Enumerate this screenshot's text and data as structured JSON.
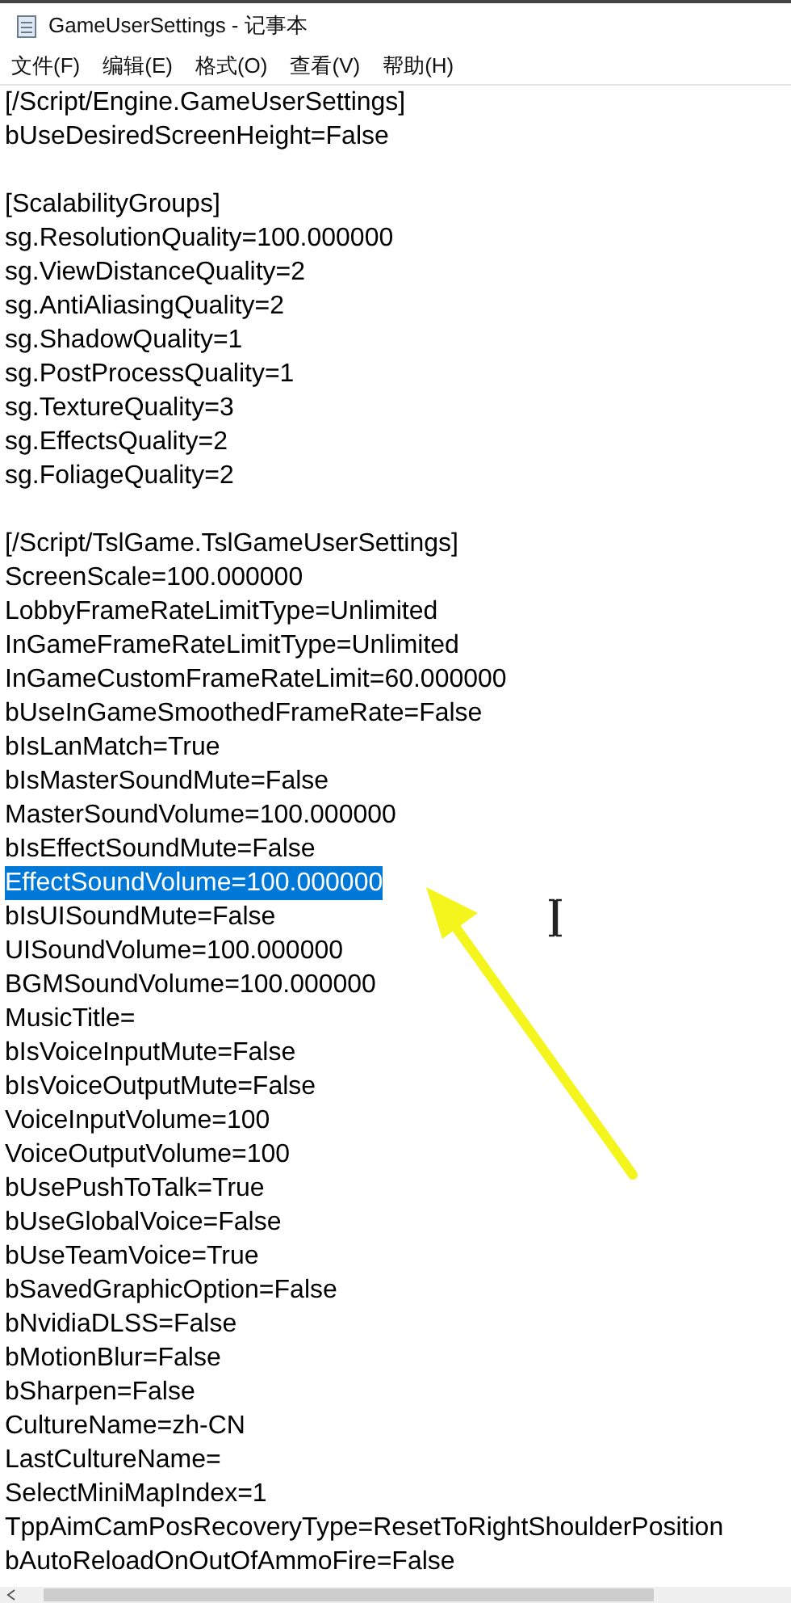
{
  "window": {
    "title": "GameUserSettings - 记事本"
  },
  "menu": [
    "文件(F)",
    "编辑(E)",
    "格式(O)",
    "查看(V)",
    "帮助(H)"
  ],
  "lines": [
    {
      "kind": "text",
      "text": "[/Script/Engine.GameUserSettings]",
      "selected": false
    },
    {
      "kind": "text",
      "text": "bUseDesiredScreenHeight=False",
      "selected": false
    },
    {
      "kind": "blank"
    },
    {
      "kind": "text",
      "text": "[ScalabilityGroups]",
      "selected": false
    },
    {
      "kind": "text",
      "text": "sg.ResolutionQuality=100.000000",
      "selected": false
    },
    {
      "kind": "text",
      "text": "sg.ViewDistanceQuality=2",
      "selected": false
    },
    {
      "kind": "text",
      "text": "sg.AntiAliasingQuality=2",
      "selected": false
    },
    {
      "kind": "text",
      "text": "sg.ShadowQuality=1",
      "selected": false
    },
    {
      "kind": "text",
      "text": "sg.PostProcessQuality=1",
      "selected": false
    },
    {
      "kind": "text",
      "text": "sg.TextureQuality=3",
      "selected": false
    },
    {
      "kind": "text",
      "text": "sg.EffectsQuality=2",
      "selected": false
    },
    {
      "kind": "text",
      "text": "sg.FoliageQuality=2",
      "selected": false
    },
    {
      "kind": "blank"
    },
    {
      "kind": "text",
      "text": "[/Script/TslGame.TslGameUserSettings]",
      "selected": false
    },
    {
      "kind": "text",
      "text": "ScreenScale=100.000000",
      "selected": false
    },
    {
      "kind": "text",
      "text": "LobbyFrameRateLimitType=Unlimited",
      "selected": false
    },
    {
      "kind": "text",
      "text": "InGameFrameRateLimitType=Unlimited",
      "selected": false
    },
    {
      "kind": "text",
      "text": "InGameCustomFrameRateLimit=60.000000",
      "selected": false
    },
    {
      "kind": "text",
      "text": "bUseInGameSmoothedFrameRate=False",
      "selected": false
    },
    {
      "kind": "text",
      "text": "bIsLanMatch=True",
      "selected": false
    },
    {
      "kind": "text",
      "text": "bIsMasterSoundMute=False",
      "selected": false
    },
    {
      "kind": "text",
      "text": "MasterSoundVolume=100.000000",
      "selected": false
    },
    {
      "kind": "text",
      "text": "bIsEffectSoundMute=False",
      "selected": false
    },
    {
      "kind": "text",
      "text": "EffectSoundVolume=100.000000",
      "selected": true
    },
    {
      "kind": "text",
      "text": "bIsUISoundMute=False",
      "selected": false
    },
    {
      "kind": "text",
      "text": "UISoundVolume=100.000000",
      "selected": false
    },
    {
      "kind": "text",
      "text": "BGMSoundVolume=100.000000",
      "selected": false
    },
    {
      "kind": "text",
      "text": "MusicTitle=",
      "selected": false
    },
    {
      "kind": "text",
      "text": "bIsVoiceInputMute=False",
      "selected": false
    },
    {
      "kind": "text",
      "text": "bIsVoiceOutputMute=False",
      "selected": false
    },
    {
      "kind": "text",
      "text": "VoiceInputVolume=100",
      "selected": false
    },
    {
      "kind": "text",
      "text": "VoiceOutputVolume=100",
      "selected": false
    },
    {
      "kind": "text",
      "text": "bUsePushToTalk=True",
      "selected": false
    },
    {
      "kind": "text",
      "text": "bUseGlobalVoice=False",
      "selected": false
    },
    {
      "kind": "text",
      "text": "bUseTeamVoice=True",
      "selected": false
    },
    {
      "kind": "text",
      "text": "bSavedGraphicOption=False",
      "selected": false
    },
    {
      "kind": "text",
      "text": "bNvidiaDLSS=False",
      "selected": false
    },
    {
      "kind": "text",
      "text": "bMotionBlur=False",
      "selected": false
    },
    {
      "kind": "text",
      "text": "bSharpen=False",
      "selected": false
    },
    {
      "kind": "text",
      "text": "CultureName=zh-CN",
      "selected": false
    },
    {
      "kind": "text",
      "text": "LastCultureName=",
      "selected": false
    },
    {
      "kind": "text",
      "text": "SelectMiniMapIndex=1",
      "selected": false
    },
    {
      "kind": "text",
      "text": "TppAimCamPosRecoveryType=ResetToRightShoulderPosition",
      "selected": false
    },
    {
      "kind": "text",
      "text": "bAutoReloadOnOutOfAmmoFire=False",
      "selected": false
    }
  ]
}
